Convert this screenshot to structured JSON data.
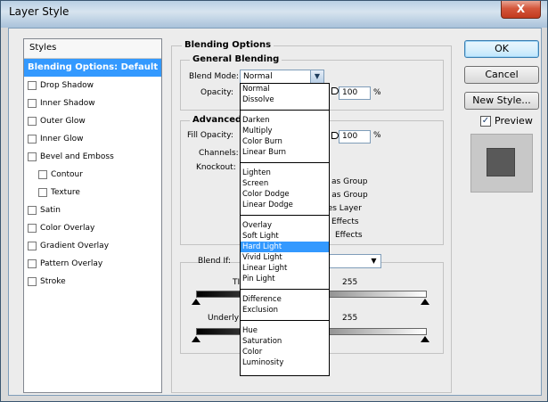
{
  "window": {
    "title": "Layer Style",
    "close_label": "X"
  },
  "styles": {
    "header": "Styles",
    "items": [
      {
        "label": "Blending Options: Default",
        "selected": true,
        "checkbox": false,
        "indent": false
      },
      {
        "label": "Drop Shadow",
        "checkbox": true,
        "indent": false
      },
      {
        "label": "Inner Shadow",
        "checkbox": true,
        "indent": false
      },
      {
        "label": "Outer Glow",
        "checkbox": true,
        "indent": false
      },
      {
        "label": "Inner Glow",
        "checkbox": true,
        "indent": false
      },
      {
        "label": "Bevel and Emboss",
        "checkbox": true,
        "indent": false
      },
      {
        "label": "Contour",
        "checkbox": true,
        "indent": true
      },
      {
        "label": "Texture",
        "checkbox": true,
        "indent": true
      },
      {
        "label": "Satin",
        "checkbox": true,
        "indent": false
      },
      {
        "label": "Color Overlay",
        "checkbox": true,
        "indent": false
      },
      {
        "label": "Gradient Overlay",
        "checkbox": true,
        "indent": false
      },
      {
        "label": "Pattern Overlay",
        "checkbox": true,
        "indent": false
      },
      {
        "label": "Stroke",
        "checkbox": true,
        "indent": false
      }
    ]
  },
  "blending": {
    "section_title": "Blending Options",
    "general_title": "General Blending",
    "blend_mode_label": "Blend Mode:",
    "blend_mode_value": "Normal",
    "opacity_label": "Opacity:",
    "opacity_value": "100",
    "percent": "%",
    "advanced_title": "Advanced",
    "fill_opacity_label": "Fill Opacity:",
    "fill_opacity_value": "100",
    "channels_label": "Channels:",
    "knockout_label": "Knockout:",
    "partial_texts": [
      "cts as Group",
      "rs as Group",
      "pes Layer",
      "Effects",
      "Effects"
    ],
    "blend_if_label": "Blend If:",
    "this_layer_label": "TI",
    "this_layer_value": "255",
    "underlying_label": "Underlyi",
    "underlying_value": "255"
  },
  "blend_mode_options": [
    [
      "Normal",
      "Dissolve"
    ],
    [
      "Darken",
      "Multiply",
      "Color Burn",
      "Linear Burn"
    ],
    [
      "Lighten",
      "Screen",
      "Color Dodge",
      "Linear Dodge"
    ],
    [
      "Overlay",
      "Soft Light",
      "Hard Light",
      "Vivid Light",
      "Linear Light",
      "Pin Light"
    ],
    [
      "Difference",
      "Exclusion"
    ],
    [
      "Hue",
      "Saturation",
      "Color",
      "Luminosity"
    ]
  ],
  "highlighted_option": "Hard Light",
  "buttons": {
    "ok": "OK",
    "cancel": "Cancel",
    "new_style": "New Style..."
  },
  "preview": {
    "label": "Preview",
    "checked": true,
    "checkmark": "✓"
  },
  "colors": {
    "accent": "#3399ff",
    "swatch": "#595959"
  }
}
